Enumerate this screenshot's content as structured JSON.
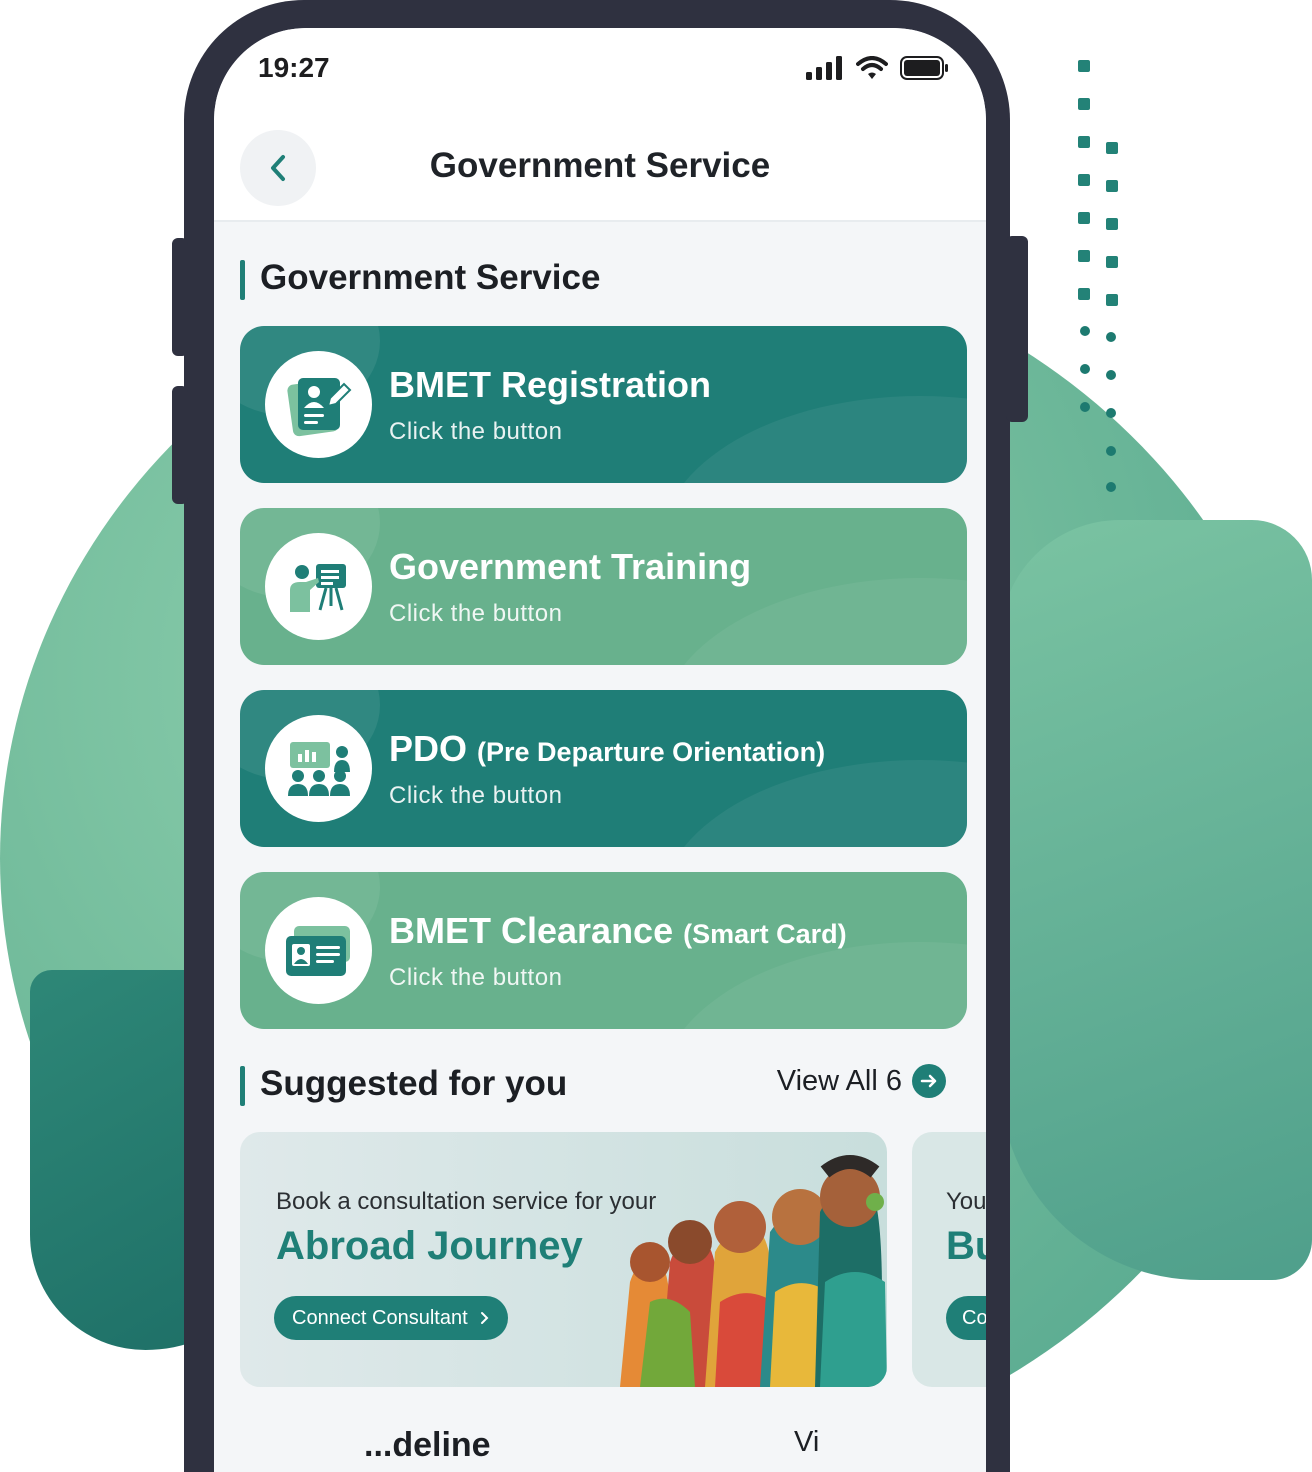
{
  "status_bar": {
    "time": "19:27"
  },
  "header": {
    "title": "Government Service"
  },
  "government_section": {
    "title": "Government Service",
    "items": [
      {
        "title": "BMET Registration",
        "title_sub": "",
        "caption": "Click the button",
        "icon": "registration-form-icon",
        "style": "dark"
      },
      {
        "title": "Government Training",
        "title_sub": "",
        "caption": "Click the button",
        "icon": "training-presentation-icon",
        "style": "light"
      },
      {
        "title": "PDO",
        "title_sub": "(Pre Departure Orientation)",
        "caption": "Click the button",
        "icon": "classroom-orientation-icon",
        "style": "dark"
      },
      {
        "title": "BMET Clearance",
        "title_sub": "(Smart Card)",
        "caption": "Click the button",
        "icon": "smart-card-icon",
        "style": "light"
      }
    ]
  },
  "suggested_section": {
    "title": "Suggested for you",
    "view_all_label": "View All 6",
    "cards": [
      {
        "pre_text": "Book a consultation service for your",
        "title": "Abroad Journey",
        "button_label": "Connect Consultant"
      },
      {
        "pre_text": "You",
        "title": "Bu",
        "button_label": "Co"
      }
    ]
  },
  "next_section": {
    "title": "...deline",
    "link": "Vi"
  },
  "colors": {
    "primary_dark": "#1f7e77",
    "primary_light": "#68b18d",
    "background": "#f4f6f8"
  }
}
